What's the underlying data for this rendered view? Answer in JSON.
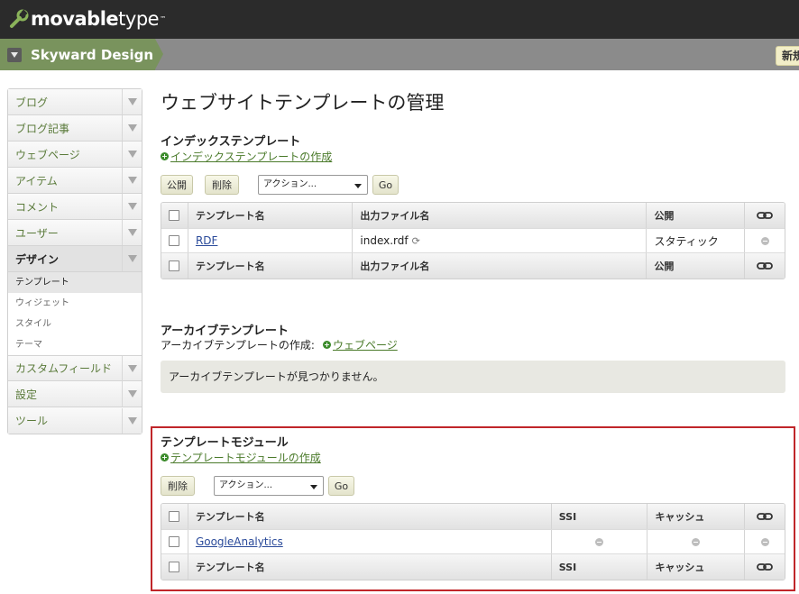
{
  "header": {
    "logo_bold": "movable",
    "logo_light": "type",
    "logo_tm": "™",
    "site_name": "Skyward Design",
    "new_button": "新規"
  },
  "sidebar": {
    "items": [
      {
        "label": "ブログ"
      },
      {
        "label": "ブログ記事"
      },
      {
        "label": "ウェブページ"
      },
      {
        "label": "アイテム"
      },
      {
        "label": "コメント"
      },
      {
        "label": "ユーザー"
      },
      {
        "label": "デザイン"
      },
      {
        "label": "カスタムフィールド"
      },
      {
        "label": "設定"
      },
      {
        "label": "ツール"
      }
    ],
    "design_sub": [
      {
        "label": "テンプレート"
      },
      {
        "label": "ウィジェット"
      },
      {
        "label": "スタイル"
      },
      {
        "label": "テーマ"
      }
    ]
  },
  "main": {
    "title": "ウェブサイトテンプレートの管理",
    "index": {
      "heading": "インデックステンプレート",
      "create_link": "インデックステンプレートの作成",
      "publish_btn": "公開",
      "delete_btn": "削除",
      "action_select": "アクション...",
      "go_btn": "Go",
      "columns": [
        "テンプレート名",
        "出力ファイル名",
        "公開"
      ],
      "rows": [
        {
          "name": "RDF",
          "output": "index.rdf",
          "publish": "スタティック"
        }
      ]
    },
    "archive": {
      "heading": "アーカイブテンプレート",
      "create_label": "アーカイブテンプレートの作成:",
      "create_link": "ウェブページ",
      "empty_msg": "アーカイブテンプレートが見つかりません。"
    },
    "modules": {
      "heading": "テンプレートモジュール",
      "create_link": "テンプレートモジュールの作成",
      "delete_btn": "削除",
      "action_select": "アクション...",
      "go_btn": "Go",
      "columns": [
        "テンプレート名",
        "SSI",
        "キャッシュ"
      ],
      "rows": [
        {
          "name": "GoogleAnalytics"
        }
      ]
    }
  },
  "colors": {
    "site_bar_green": "#79935d",
    "highlight_red": "#c0262a",
    "link_blue": "#2a4a9a"
  }
}
